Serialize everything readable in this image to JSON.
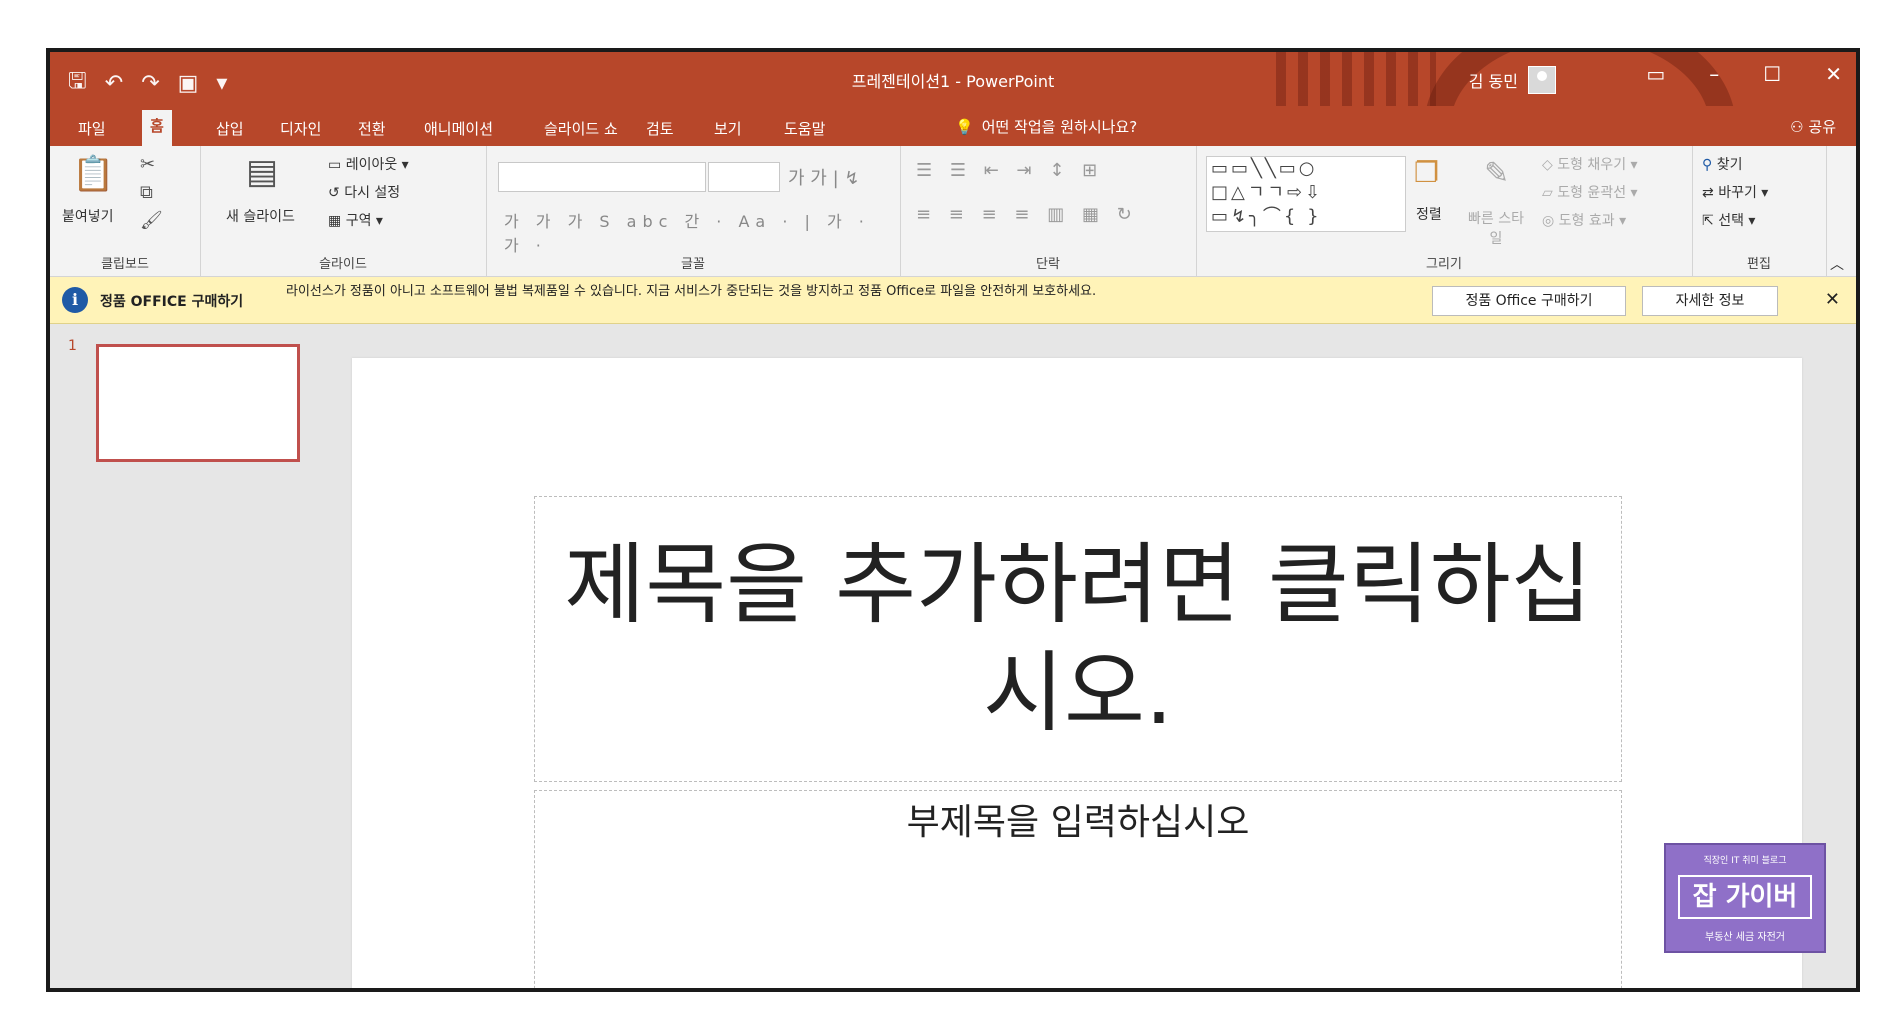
{
  "titlebar": {
    "doc_title": "프레젠테이션1 - PowerPoint",
    "user_name": "김 동민",
    "qat": [
      "save-icon",
      "undo-icon",
      "redo-icon",
      "present-icon",
      "customize-icon"
    ]
  },
  "tabs": [
    "파일",
    "홈",
    "삽입",
    "디자인",
    "전환",
    "애니메이션",
    "슬라이드 쇼",
    "검토",
    "보기",
    "도움말"
  ],
  "tell_me": "어떤 작업을 원하시나요?",
  "share": "공유",
  "ribbon": {
    "clipboard": {
      "paste": "붙여넣기",
      "label": "클립보드"
    },
    "slides": {
      "new_slide": "새 슬라이드",
      "layout": "레이아웃",
      "reset": "다시 설정",
      "section": "구역",
      "label": "슬라이드"
    },
    "font": {
      "label": "글꼴"
    },
    "paragraph": {
      "label": "단락"
    },
    "drawing": {
      "arrange": "정렬",
      "quick_styles": "빠른 스타일",
      "fill": "도형 채우기",
      "outline": "도형 윤곽선",
      "effects": "도형 효과",
      "label": "그리기"
    },
    "editing": {
      "find": "찾기",
      "replace": "바꾸기",
      "select": "선택",
      "label": "편집"
    }
  },
  "infobar": {
    "title": "정품 OFFICE 구매하기",
    "message": "라이선스가 정품이 아니고 소프트웨어 불법 복제품일 수 있습니다. 지금 서비스가 중단되는 것을 방지하고 정품 Office로 파일을 안전하게 보호하세요.",
    "buy_button": "정품 Office 구매하기",
    "info_button": "자세한 정보"
  },
  "thumbnail": {
    "number": "1"
  },
  "slide": {
    "title_placeholder": "제목을 추가하려면 클릭하십시오.",
    "subtitle_placeholder": "부제목을 입력하십시오"
  },
  "watermark": {
    "line1": "직장인 IT 취미 블로그",
    "line2": "잡 가이버",
    "line3": "부동산 세금 자전거"
  },
  "colors": {
    "accent": "#b7472a",
    "infobar": "#fff3b8"
  }
}
